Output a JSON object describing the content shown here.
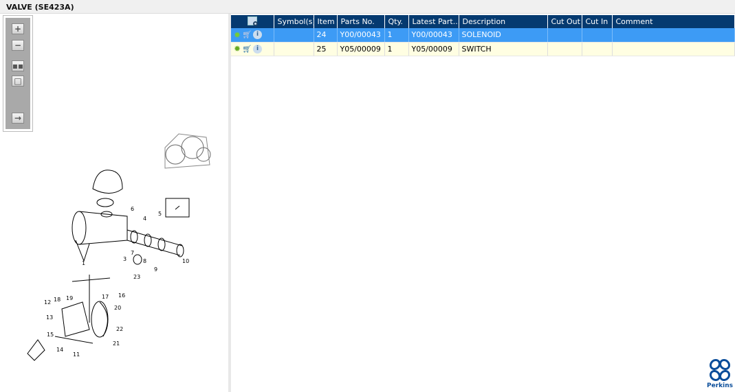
{
  "title": "VALVE (SE423A)",
  "toolbar": {
    "buttons": [
      "zoom-in",
      "zoom-out",
      "fit-all",
      "fit-page",
      "export"
    ]
  },
  "table": {
    "columns": [
      "",
      "Symbol(s)",
      "Item",
      "Parts No.",
      "Qty.",
      "Latest Part...",
      "Description",
      "Cut Out",
      "Cut In",
      "Comment"
    ],
    "rows": [
      {
        "symbols": "",
        "item": "24",
        "part_no": "Y00/00043",
        "qty": "1",
        "latest": "Y00/00043",
        "description": "SOLENOID",
        "cut_out": "",
        "cut_in": "",
        "comment": "",
        "selected": true
      },
      {
        "symbols": "",
        "item": "25",
        "part_no": "Y05/00009",
        "qty": "1",
        "latest": "Y05/00009",
        "description": "SWITCH",
        "cut_out": "",
        "cut_in": "",
        "comment": "",
        "selected": false
      }
    ]
  },
  "callouts": [
    "1",
    "3",
    "4",
    "5",
    "6",
    "7",
    "8",
    "9",
    "10",
    "23",
    "11",
    "12",
    "13",
    "14",
    "15",
    "16",
    "17",
    "18",
    "19",
    "20",
    "21",
    "22"
  ],
  "logo": "Perkins",
  "colors": {
    "header": "#053a70",
    "selected": "#3d9bf5",
    "alt_row": "#fffee2"
  }
}
